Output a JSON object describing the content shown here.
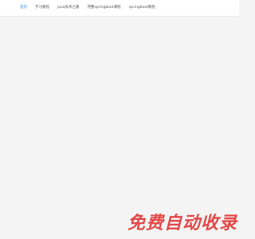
{
  "nav": {
    "items": [
      {
        "label": "首页",
        "active": true
      },
      {
        "label": "学习教程",
        "active": false
      },
      {
        "label": "java技术之路",
        "active": false
      },
      {
        "label": "完整springboot课程",
        "active": false
      },
      {
        "label": "springboot教程",
        "active": false
      }
    ]
  },
  "watermark": {
    "text": "免费自动收录"
  },
  "colors": {
    "accent": "#2f7be6",
    "nav_text": "#555555",
    "background": "#f4f4f4",
    "topbar": "#ffffff",
    "watermark": "#e23a3a"
  }
}
